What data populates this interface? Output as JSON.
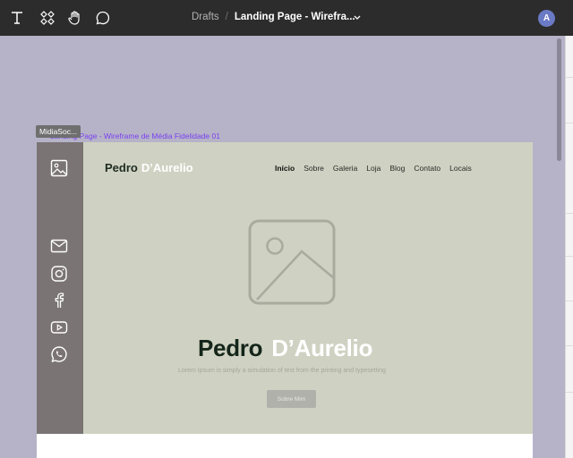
{
  "toolbar": {
    "tools": [
      "text-tool",
      "components-tool",
      "hand-tool",
      "comment-tool"
    ],
    "breadcrumb_root": "Drafts",
    "breadcrumb_sep": "/",
    "file_title": "Landing Page - Wirefra...",
    "avatar_initial": "A"
  },
  "canvas": {
    "frame_name": "Landing Page - Wireframe de Média Fidelidade 01",
    "selected_tag": "MidiaSoc..."
  },
  "frame": {
    "sidebar_icons": [
      "image-icon",
      "mail-icon",
      "instagram-icon",
      "facebook-icon",
      "youtube-icon",
      "whatsapp-icon"
    ],
    "logo_first": "Pedro",
    "logo_last": "D’Aurelio",
    "nav": [
      "Início",
      "Sobre",
      "Galeria",
      "Loja",
      "Blog",
      "Contato",
      "Locais"
    ],
    "hero_title_first": "Pedro",
    "hero_title_last": "D’Aurelio",
    "hero_subtitle": "Lorem Ipsum is simply a simulation of text from the printing and typesetting",
    "hero_button": "Sobre Mim"
  },
  "colors": {
    "toolbar_bg": "#2c2c2c",
    "canvas_bg": "#b6b3c8",
    "hero_bg": "#cfd2c2",
    "sidebar_bg": "#7a7474",
    "label_accent": "#7a3ff0"
  }
}
